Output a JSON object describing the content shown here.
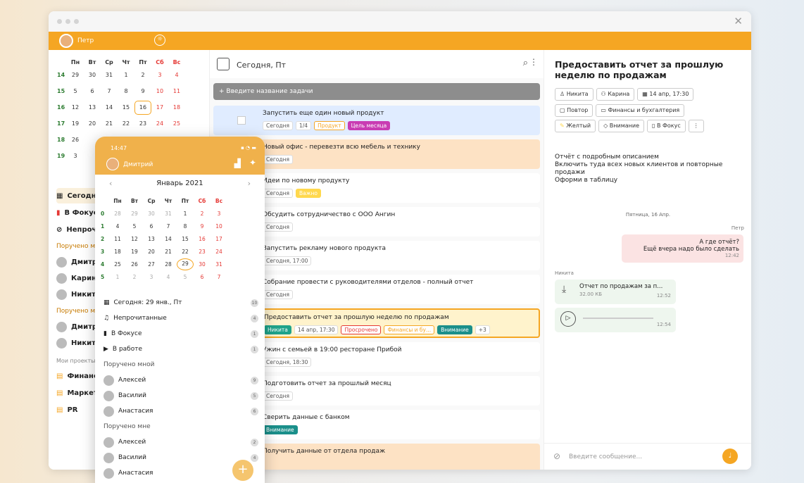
{
  "app": {
    "user": "Петр"
  },
  "calendar": {
    "headers": [
      "Пн",
      "Вт",
      "Ср",
      "Чт",
      "Пт",
      "Сб",
      "Вс"
    ],
    "weeks": [
      {
        "wk": "14",
        "days": [
          "29",
          "30",
          "31",
          "1",
          "2",
          "3",
          "4"
        ]
      },
      {
        "wk": "15",
        "days": [
          "5",
          "6",
          "7",
          "8",
          "9",
          "10",
          "11"
        ]
      },
      {
        "wk": "16",
        "days": [
          "12",
          "13",
          "14",
          "15",
          "16",
          "17",
          "18"
        ]
      },
      {
        "wk": "17",
        "days": [
          "19",
          "20",
          "21",
          "22",
          "23",
          "24",
          "25"
        ]
      },
      {
        "wk": "18",
        "days": [
          "26",
          "",
          "",
          "",
          "",
          "",
          ""
        ]
      },
      {
        "wk": "19",
        "days": [
          "3",
          "",
          "",
          "",
          "",
          "",
          ""
        ]
      }
    ]
  },
  "sidebar": {
    "items": [
      "Сегодня",
      "В Фокусе",
      "Непрочитанные"
    ],
    "section1": "Поручено мной",
    "people1": [
      "Дмитрий",
      "Карина",
      "Никита"
    ],
    "section2": "Поручено мне",
    "people2": [
      "Дмитрий",
      "Никита"
    ],
    "section3": "Мои проекты",
    "projects": [
      "Финансы",
      "Маркетинг",
      "PR"
    ]
  },
  "middle": {
    "title": "Сегодня, Пт",
    "new_task": "+ Введите название задачи",
    "tasks": [
      {
        "title": "Запустить еще один новый продукт",
        "chips": [
          "Сегодня",
          "1/4",
          "Продукт",
          "Цель месяца"
        ]
      },
      {
        "title": "Новый офис - перевезти всю мебель и технику",
        "chips": [
          "Сегодня"
        ]
      },
      {
        "title": "Идеи по новому продукту",
        "chips": [
          "Сегодня",
          "Важно"
        ]
      },
      {
        "title": "Обсудить сотрудничество с ООО Ангин",
        "chips": [
          "Сегодня"
        ]
      },
      {
        "title": "Запустить рекламу нового продукта",
        "chips": [
          "Сегодня, 17:00"
        ]
      },
      {
        "title": "Собрание провести с руководителями отделов - полный отчет",
        "chips": [
          "Сегодня"
        ]
      },
      {
        "title": "Предоставить отчет за прошлую неделю по продажам",
        "chips": [
          "Никита",
          "14 апр, 17:30",
          "Просрочено",
          "Финансы и бу...",
          "Внимание",
          "+3"
        ]
      },
      {
        "title": "Ужин с семьей в 19:00 ресторане Прибой",
        "chips": [
          "Сегодня, 18:30"
        ]
      },
      {
        "title": "Подготовить отчет за прошлый месяц",
        "chips": [
          "Сегодня"
        ]
      },
      {
        "title": "Сверить данные с банком",
        "chips": [
          "Внимание"
        ]
      },
      {
        "title": "Получить данные от отдела продаж",
        "chips": []
      }
    ]
  },
  "detail": {
    "title": "Предоставить отчет за прошлую неделю по продажам",
    "row1": [
      "Никита",
      "Карина",
      "14 апр, 17:30"
    ],
    "row2": [
      "Повтор",
      "Финансы и бухгалтерия"
    ],
    "row3": [
      "Желтый",
      "Внимание",
      "В Фокус"
    ],
    "description": [
      "Отчёт с подробным описанием",
      "Включить туда всех новых клиентов и повторные продажи",
      "Оформи в таблицу"
    ],
    "date": "Пятница, 16 Апр.",
    "msg1_author": "Петр",
    "msg1": [
      "А где отчёт?",
      "Ещё вчера надо было сделать"
    ],
    "msg1_time": "12:42",
    "msg2_author": "Никита",
    "file_name": "Отчет по продажам за п...",
    "file_size": "32.00 КБ",
    "file_time": "12:52",
    "audio_time": "12:54",
    "input_placeholder": "Введите сообщение..."
  },
  "phone": {
    "time": "14:47",
    "user": "Дмитрий",
    "month": "Январь 2021",
    "weeks": [
      {
        "wk": "0",
        "days": [
          "28",
          "29",
          "30",
          "31",
          "1",
          "2",
          "3"
        ]
      },
      {
        "wk": "1",
        "days": [
          "4",
          "5",
          "6",
          "7",
          "8",
          "9",
          "10"
        ]
      },
      {
        "wk": "2",
        "days": [
          "11",
          "12",
          "13",
          "14",
          "15",
          "16",
          "17"
        ]
      },
      {
        "wk": "3",
        "days": [
          "18",
          "19",
          "20",
          "21",
          "22",
          "23",
          "24"
        ]
      },
      {
        "wk": "4",
        "days": [
          "25",
          "26",
          "27",
          "28",
          "29",
          "30",
          "31"
        ]
      },
      {
        "wk": "5",
        "days": [
          "1",
          "2",
          "3",
          "4",
          "5",
          "6",
          "7"
        ]
      }
    ],
    "list": [
      {
        "label": "Сегодня: 29 янв., Пт",
        "count": "10"
      },
      {
        "label": "Непрочитанные",
        "count": "4"
      },
      {
        "label": "В Фокусе",
        "count": "1"
      },
      {
        "label": "В работе",
        "count": "1"
      }
    ],
    "section1": "Поручено мной",
    "p1": [
      {
        "n": "Алексей",
        "c": "9"
      },
      {
        "n": "Василий",
        "c": "5"
      },
      {
        "n": "Анастасия",
        "c": "6"
      }
    ],
    "section2": "Поручено мне",
    "p2": [
      {
        "n": "Алексей",
        "c": "2"
      },
      {
        "n": "Василий",
        "c": "4"
      },
      {
        "n": "Анастасия",
        "c": ""
      }
    ]
  }
}
